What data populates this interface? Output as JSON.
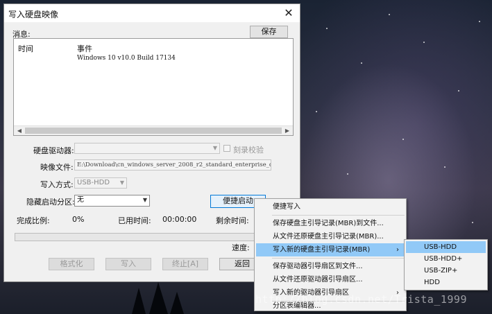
{
  "window": {
    "title": "写入硬盘映像",
    "close_glyph": "✕"
  },
  "messages": {
    "label": "消息:",
    "save_button": "保存",
    "col_time": "时间",
    "col_event": "事件",
    "rows": [
      {
        "time": "",
        "event": "Windows 10 v10.0 Build 17134"
      }
    ]
  },
  "form": {
    "disk_drive_label": "硬盘驱动器:",
    "disk_drive_value": "",
    "verify_label": "刻录校验",
    "image_file_label": "映像文件:",
    "image_file_value": "E:\\Download\\cn_windows_server_2008_r2_standard_enterprise_d",
    "write_mode_label": "写入方式:",
    "write_mode_value": "USB-HDD",
    "hidden_partition_label": "隐藏启动分区:",
    "hidden_partition_value": "无",
    "quick_boot_button": "便捷启动",
    "progress_label": "完成比例:",
    "progress_value": "0%",
    "progress_fraction": 0,
    "elapsed_label": "已用时间:",
    "elapsed_value": "00:00:00",
    "remaining_label": "剩余时间:",
    "speed_label": "速度:"
  },
  "buttons": {
    "format": "格式化",
    "write": "写入",
    "stop": "终止[A]",
    "back": "返回"
  },
  "context_menu": {
    "items": [
      {
        "label": "便捷写入"
      },
      {
        "label": "保存硬盘主引导记录(MBR)到文件..."
      },
      {
        "label": "从文件还原硬盘主引导记录(MBR)..."
      },
      {
        "label": "写入新的硬盘主引导记录(MBR)",
        "arrow": "›"
      },
      {
        "label": "保存驱动器引导扇区到文件..."
      },
      {
        "label": "从文件还原驱动器引导扇区..."
      },
      {
        "label": "写入新的驱动器引导扇区",
        "arrow": "›"
      },
      {
        "label": "分区表编辑器..."
      }
    ]
  },
  "submenu": {
    "items": [
      {
        "label": "USB-HDD"
      },
      {
        "label": "USB-HDD+"
      },
      {
        "label": "USB-ZIP+"
      },
      {
        "label": "HDD"
      }
    ]
  },
  "watermark": "http://blog.csdn.net/Trista_1999",
  "colors": {
    "highlight": "#91c9f7",
    "focus_border": "#0078d7"
  }
}
